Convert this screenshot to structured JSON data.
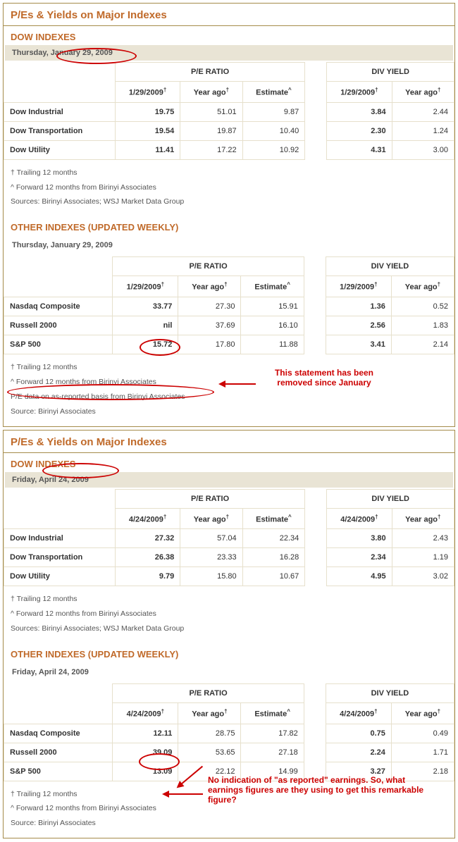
{
  "panels": [
    {
      "title": "P/Es & Yields on Major Indexes",
      "sections": [
        {
          "subtitle": "DOW INDEXES",
          "dateBarStyle": "shaded",
          "date": "Thursday, January 29, 2009",
          "col_date": "1/29/2009",
          "headers": {
            "pe": "P/E RATIO",
            "div": "DIV YIELD",
            "year_ago": "Year ago",
            "estimate": "Estimate"
          },
          "rows": [
            {
              "label": "Dow Industrial",
              "pe_date": "19.75",
              "pe_year": "51.01",
              "pe_est": "9.87",
              "div_date": "3.84",
              "div_year": "2.44"
            },
            {
              "label": "Dow Transportation",
              "pe_date": "19.54",
              "pe_year": "19.87",
              "pe_est": "10.40",
              "div_date": "2.30",
              "div_year": "1.24"
            },
            {
              "label": "Dow Utility",
              "pe_date": "11.41",
              "pe_year": "17.22",
              "pe_est": "10.92",
              "div_date": "4.31",
              "div_year": "3.00"
            }
          ],
          "footnotes": [
            "† Trailing 12 months",
            "^ Forward 12 months from Birinyi Associates",
            "Sources: Birinyi Associates; WSJ Market Data Group"
          ]
        },
        {
          "subtitle": "OTHER INDEXES (UPDATED WEEKLY)",
          "dateBarStyle": "plain",
          "date": "Thursday, January 29, 2009",
          "col_date": "1/29/2009",
          "headers": {
            "pe": "P/E RATIO",
            "div": "DIV YIELD",
            "year_ago": "Year ago",
            "estimate": "Estimate"
          },
          "rows": [
            {
              "label": "Nasdaq Composite",
              "pe_date": "33.77",
              "pe_year": "27.30",
              "pe_est": "15.91",
              "div_date": "1.36",
              "div_year": "0.52"
            },
            {
              "label": "Russell 2000",
              "pe_date": "nil",
              "pe_year": "37.69",
              "pe_est": "16.10",
              "div_date": "2.56",
              "div_year": "1.83"
            },
            {
              "label": "S&P 500",
              "pe_date": "15.72",
              "pe_year": "17.80",
              "pe_est": "11.88",
              "div_date": "3.41",
              "div_year": "2.14"
            }
          ],
          "footnotes": [
            "† Trailing 12 months",
            "^ Forward 12 months from Birinyi Associates",
            "P/E data on as-reported basis from Birinyi Associates",
            "Source: Birinyi Associates"
          ]
        }
      ]
    },
    {
      "title": "P/Es & Yields on Major Indexes",
      "sections": [
        {
          "subtitle": "DOW INDEXES",
          "dateBarStyle": "shaded",
          "date": "Friday, April 24, 2009",
          "col_date": "4/24/2009",
          "headers": {
            "pe": "P/E RATIO",
            "div": "DIV YIELD",
            "year_ago": "Year ago",
            "estimate": "Estimate"
          },
          "rows": [
            {
              "label": "Dow Industrial",
              "pe_date": "27.32",
              "pe_year": "57.04",
              "pe_est": "22.34",
              "div_date": "3.80",
              "div_year": "2.43"
            },
            {
              "label": "Dow Transportation",
              "pe_date": "26.38",
              "pe_year": "23.33",
              "pe_est": "16.28",
              "div_date": "2.34",
              "div_year": "1.19"
            },
            {
              "label": "Dow Utility",
              "pe_date": "9.79",
              "pe_year": "15.80",
              "pe_est": "10.67",
              "div_date": "4.95",
              "div_year": "3.02"
            }
          ],
          "footnotes": [
            "† Trailing 12 months",
            "^ Forward 12 months from Birinyi Associates",
            "Sources: Birinyi Associates; WSJ Market Data Group"
          ]
        },
        {
          "subtitle": "OTHER INDEXES (UPDATED WEEKLY)",
          "dateBarStyle": "plain",
          "date": "Friday, April 24, 2009",
          "col_date": "4/24/2009",
          "headers": {
            "pe": "P/E RATIO",
            "div": "DIV YIELD",
            "year_ago": "Year ago",
            "estimate": "Estimate"
          },
          "rows": [
            {
              "label": "Nasdaq Composite",
              "pe_date": "12.11",
              "pe_year": "28.75",
              "pe_est": "17.82",
              "div_date": "0.75",
              "div_year": "0.49"
            },
            {
              "label": "Russell 2000",
              "pe_date": "39.09",
              "pe_year": "53.65",
              "pe_est": "27.18",
              "div_date": "2.24",
              "div_year": "1.71"
            },
            {
              "label": "S&P 500",
              "pe_date": "13.09",
              "pe_year": "22.12",
              "pe_est": "14.99",
              "div_date": "3.27",
              "div_year": "2.18"
            }
          ],
          "footnotes": [
            "† Trailing 12 months",
            "^ Forward 12 months from Birinyi Associates",
            "Source: Birinyi Associates"
          ]
        }
      ]
    }
  ],
  "annotations": {
    "a1": "This statement has been removed since January",
    "a2": "No indication of \"as reported\" earnings. So, what earnings figures are they using to get this remarkable figure?"
  },
  "chart_data": [
    {
      "type": "table",
      "title": "DOW INDEXES 1/29/2009",
      "columns": [
        "Index",
        "P/E 1/29/2009",
        "P/E Year ago",
        "P/E Estimate",
        "Div 1/29/2009",
        "Div Year ago"
      ],
      "rows": [
        [
          "Dow Industrial",
          19.75,
          51.01,
          9.87,
          3.84,
          2.44
        ],
        [
          "Dow Transportation",
          19.54,
          19.87,
          10.4,
          2.3,
          1.24
        ],
        [
          "Dow Utility",
          11.41,
          17.22,
          10.92,
          4.31,
          3.0
        ]
      ]
    },
    {
      "type": "table",
      "title": "OTHER INDEXES 1/29/2009",
      "columns": [
        "Index",
        "P/E 1/29/2009",
        "P/E Year ago",
        "P/E Estimate",
        "Div 1/29/2009",
        "Div Year ago"
      ],
      "rows": [
        [
          "Nasdaq Composite",
          33.77,
          27.3,
          15.91,
          1.36,
          0.52
        ],
        [
          "Russell 2000",
          "nil",
          37.69,
          16.1,
          2.56,
          1.83
        ],
        [
          "S&P 500",
          15.72,
          17.8,
          11.88,
          3.41,
          2.14
        ]
      ]
    },
    {
      "type": "table",
      "title": "DOW INDEXES 4/24/2009",
      "columns": [
        "Index",
        "P/E 4/24/2009",
        "P/E Year ago",
        "P/E Estimate",
        "Div 4/24/2009",
        "Div Year ago"
      ],
      "rows": [
        [
          "Dow Industrial",
          27.32,
          57.04,
          22.34,
          3.8,
          2.43
        ],
        [
          "Dow Transportation",
          26.38,
          23.33,
          16.28,
          2.34,
          1.19
        ],
        [
          "Dow Utility",
          9.79,
          15.8,
          10.67,
          4.95,
          3.02
        ]
      ]
    },
    {
      "type": "table",
      "title": "OTHER INDEXES 4/24/2009",
      "columns": [
        "Index",
        "P/E 4/24/2009",
        "P/E Year ago",
        "P/E Estimate",
        "Div 4/24/2009",
        "Div Year ago"
      ],
      "rows": [
        [
          "Nasdaq Composite",
          12.11,
          28.75,
          17.82,
          0.75,
          0.49
        ],
        [
          "Russell 2000",
          39.09,
          53.65,
          27.18,
          2.24,
          1.71
        ],
        [
          "S&P 500",
          13.09,
          22.12,
          14.99,
          3.27,
          2.18
        ]
      ]
    }
  ]
}
